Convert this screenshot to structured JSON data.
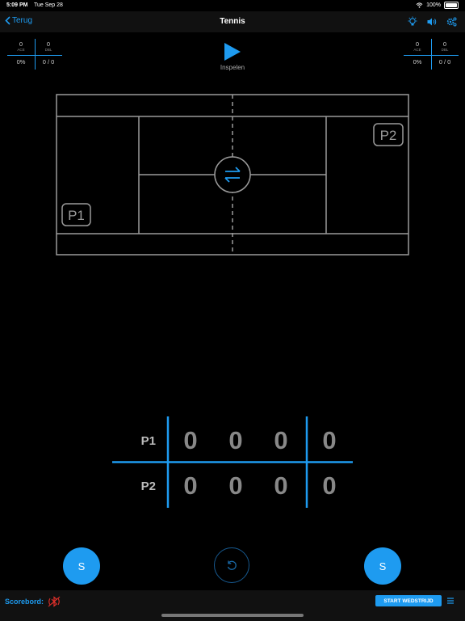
{
  "status_bar": {
    "time": "5:09 PM",
    "date": "Tue Sep 28",
    "battery": "100%"
  },
  "nav": {
    "back_label": "Terug",
    "title": "Tennis"
  },
  "stats_left": {
    "ace": "0",
    "ace_label": "ACE",
    "dbl": "0",
    "dbl_label": "DBL",
    "pct": "0%",
    "ratio": "0 / 0"
  },
  "stats_right": {
    "ace": "0",
    "ace_label": "ACE",
    "dbl": "0",
    "dbl_label": "DBL",
    "pct": "0%",
    "ratio": "0 / 0"
  },
  "warmup": {
    "label": "Inspelen"
  },
  "court": {
    "p1": "P1",
    "p2": "P2"
  },
  "scoreboard": {
    "rows": [
      {
        "player": "P1",
        "cells": [
          "0",
          "0",
          "0",
          "0"
        ]
      },
      {
        "player": "P2",
        "cells": [
          "0",
          "0",
          "0",
          "0"
        ]
      }
    ]
  },
  "serve": {
    "left_label": "S",
    "right_label": "S"
  },
  "bottom": {
    "scoreboard_label": "Scorebord:",
    "start_label": "START WEDSTRIJD"
  },
  "colors": {
    "accent": "#1e9bf0",
    "disconnected": "#e0302a",
    "court_line": "#9a9a9a"
  }
}
